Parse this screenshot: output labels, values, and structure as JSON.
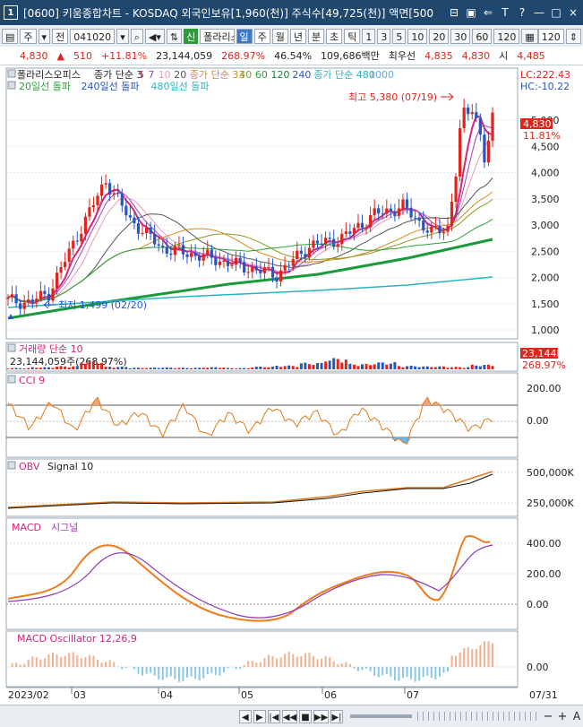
{
  "window": {
    "number": "1",
    "title": "[0600] 키움종합차트 - KOSDAQ 외국인보유[1,960(천)] 주식수[49,725(천)] 액면[500",
    "controls": [
      "⊟",
      "▣",
      "⇐",
      "T",
      "?",
      "—",
      "□",
      "×"
    ]
  },
  "toolbar": {
    "market": "주",
    "prev": "전",
    "code": "041020",
    "new_label": "신",
    "stock_name": "폴라리스오",
    "periods": [
      "일",
      "주",
      "월",
      "년",
      "분",
      "초",
      "틱"
    ],
    "selected_period": "일",
    "intervals": [
      "1",
      "3",
      "5",
      "10",
      "20",
      "30",
      "60",
      "120"
    ],
    "count": "120"
  },
  "quote": {
    "price": "4,830",
    "change": "510",
    "change_pct": "+11.81%",
    "volume": "23,144,059",
    "vol_ratio": "268.97%",
    "turnover": "46.54%",
    "amount": "109,686백만",
    "best_label": "최우선",
    "best1": "4,835",
    "best2": "4,830",
    "open_label": "시",
    "open": "4,485"
  },
  "main_panel": {
    "stock_label": "폴라리스오피스",
    "ma_row1": [
      {
        "text": "종가 단순 3",
        "color": "#222222"
      },
      {
        "text": "5",
        "color": "#d6237b"
      },
      {
        "text": "7",
        "color": "#a040c0"
      },
      {
        "text": "10",
        "color": "#e99ab8"
      },
      {
        "text": "20",
        "color": "#555555"
      },
      {
        "text": "종가 단순 33",
        "color": "#d88a1d"
      },
      {
        "text": "40",
        "color": "#8a9a1f"
      },
      {
        "text": "60",
        "color": "#2aa33a"
      },
      {
        "text": "120",
        "color": "#1a7f3a"
      },
      {
        "text": "240",
        "color": "#2356c8"
      },
      {
        "text": "종가 단순 480",
        "color": "#27b5c4"
      },
      {
        "text": "1000",
        "color": "#6aa8e8"
      }
    ],
    "ma_row2": [
      {
        "text": "20일선 돌파",
        "color": "#2aa33a"
      },
      {
        "text": "240일선 돌파",
        "color": "#2356c8"
      },
      {
        "text": "480일선 돌파",
        "color": "#27b5c4"
      }
    ],
    "lc": "LC:222.43",
    "hc": "HC:-10.22",
    "high_label": "최고 5,380 (07/19)",
    "low_label": "최저 1,499 (02/20)",
    "price_tag": "4,830",
    "pct_tag": "11.81%",
    "y_ticks": [
      "5,000",
      "4,500",
      "4,000",
      "3,500",
      "3,000",
      "2,500",
      "2,000",
      "1,500",
      "1,000"
    ]
  },
  "volume_panel": {
    "title": "거래량 단순 10",
    "value": "23,144,059주(268.97%)",
    "tag1": "23,144K",
    "tag2": "268.97%"
  },
  "cci_panel": {
    "title": "CCI 9",
    "y_ticks": [
      "200.00",
      "0.00"
    ]
  },
  "obv_panel": {
    "title": "OBV",
    "signal": "Signal 10",
    "y_ticks": [
      "500,000K",
      "250,000K"
    ]
  },
  "macd_panel": {
    "title": "MACD",
    "signal": "시그널",
    "y_ticks": [
      "400.00",
      "200.00",
      "0.00"
    ]
  },
  "osc_panel": {
    "title": "MACD Oscillator 12,26,9",
    "y_ticks": [
      "0.00"
    ]
  },
  "x_axis": [
    "2023/02",
    "03",
    "04",
    "05",
    "06",
    "07",
    "07/31"
  ],
  "bottombar": {
    "buttons": [
      "◀",
      "▶",
      "|◀",
      "◀◀",
      "■",
      "▶▶",
      "▶|"
    ],
    "zoom": [
      "−",
      "+",
      "A"
    ]
  },
  "colors": {
    "up": "#e0241c",
    "down": "#2356c8",
    "background": "#ffffff",
    "cci_fill": "#f3a57a",
    "macd_line": "#f07b1a",
    "signal_line": "#8a3ab9"
  },
  "chart_data": [
    {
      "type": "line",
      "title": "",
      "series": [
        {
          "name": "종가",
          "x": [
            "2023/02",
            "03",
            "04",
            "05",
            "06",
            "07",
            "07/31"
          ],
          "values": [
            1560,
            3100,
            2450,
            2050,
            2750,
            2950,
            4830
          ]
        }
      ],
      "ylim": [
        1000,
        5400
      ],
      "grid": true,
      "legend": "top-left"
    },
    {
      "type": "bar",
      "title": "",
      "series": [
        {
          "name": "거래량",
          "values": [
            0.5,
            0.8,
            1.2,
            3.0,
            1.0,
            0.6,
            0.7,
            0.6,
            0.8,
            0.5,
            1.0,
            1.4,
            2.4,
            4.1,
            2.0,
            2.6,
            1.3,
            1.1,
            0.9,
            1.7
          ]
        }
      ],
      "ylim": [
        0,
        10
      ]
    },
    {
      "type": "line",
      "title": "",
      "series": [
        {
          "name": "CCI",
          "values": [
            110,
            -40,
            120,
            -60,
            140,
            -30,
            60,
            -80,
            100,
            -100,
            50,
            -60,
            90,
            -20,
            60,
            -90,
            80,
            -30,
            -150,
            140,
            60,
            -50,
            20
          ]
        }
      ],
      "ylim": [
        -220,
        270
      ]
    }
  ]
}
